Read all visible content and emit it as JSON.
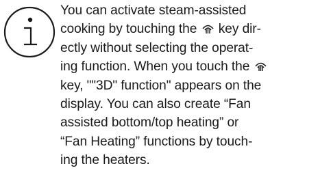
{
  "icons": {
    "info": "info-icon",
    "steam_key": "steam-key-icon"
  },
  "note": {
    "line1": "You can activate steam-assisted",
    "line2": "cooking by touching the",
    "line2_end": "key dir-",
    "line3": "ectly without selecting the operat-",
    "line4_start": "ing function. When you touch the",
    "line5": "key, \"\"3D\" function\" appears on the",
    "line6": "display. You can also create “Fan",
    "line7": "assisted bottom/top heating” or",
    "line8": "“Fan Heating” functions by touch-",
    "line9": "ing the heaters."
  }
}
